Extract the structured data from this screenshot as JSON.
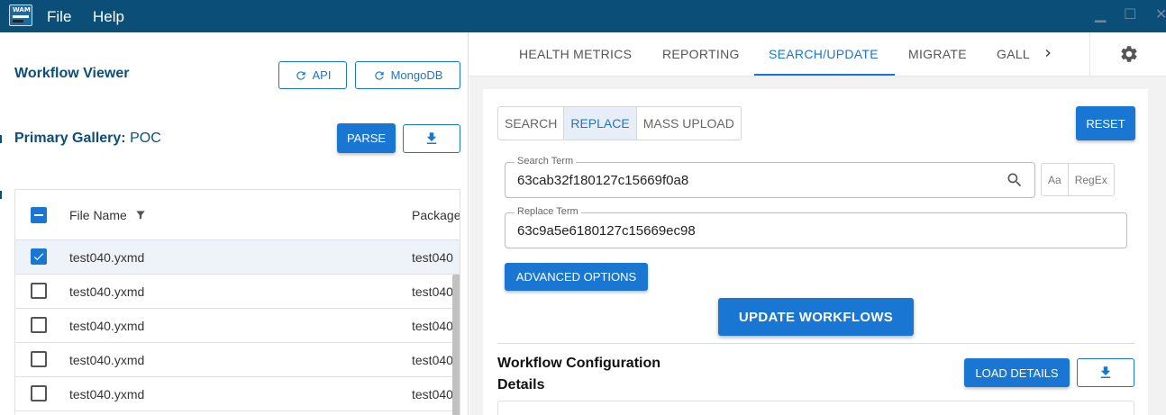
{
  "app": {
    "icon_text": "WAM",
    "menu": [
      "File",
      "Help"
    ],
    "window_controls": {
      "minimize": "▁",
      "maximize": "☐",
      "close": "✕"
    }
  },
  "left": {
    "title": "Workflow Viewer",
    "api_button": "API",
    "mongodb_button": "MongoDB",
    "primary_gallery_label": "Primary Gallery:",
    "primary_gallery_value": "POC",
    "parse_button": "PARSE",
    "table": {
      "columns": [
        "File Name",
        "Package"
      ],
      "rows": [
        {
          "file": "test040.yxmd",
          "package": "test040",
          "checked": true
        },
        {
          "file": "test040.yxmd",
          "package": "test040",
          "checked": false
        },
        {
          "file": "test040.yxmd",
          "package": "test040",
          "checked": false
        },
        {
          "file": "test040.yxmd",
          "package": "test040",
          "checked": false
        },
        {
          "file": "test040.yxmd",
          "package": "test040",
          "checked": false
        }
      ]
    }
  },
  "tabs": [
    {
      "label": "HEALTH METRICS",
      "active": false
    },
    {
      "label": "REPORTING",
      "active": false
    },
    {
      "label": "SEARCH/UPDATE",
      "active": true
    },
    {
      "label": "MIGRATE",
      "active": false
    },
    {
      "label": "GALL",
      "active": false
    }
  ],
  "search_update": {
    "modes": [
      "SEARCH",
      "REPLACE",
      "MASS UPLOAD"
    ],
    "active_mode": "REPLACE",
    "reset_button": "RESET",
    "search_term_label": "Search Term",
    "search_term_value": "63cab32f180127c15669f0a8",
    "match_case": "Aa",
    "regex": "RegEx",
    "replace_term_label": "Replace Term",
    "replace_term_value": "63c9a5e6180127c15669ec98",
    "advanced_options_button": "ADVANCED OPTIONS",
    "update_button": "UPDATE WORKFLOWS",
    "config_title_line1": "Workflow Configuration",
    "config_title_line2": "Details",
    "load_details_button": "LOAD DETAILS"
  },
  "colors": {
    "titlebar": "#0b4f79",
    "accent": "#1976d2",
    "panel_bg": "#f2f2f2"
  }
}
